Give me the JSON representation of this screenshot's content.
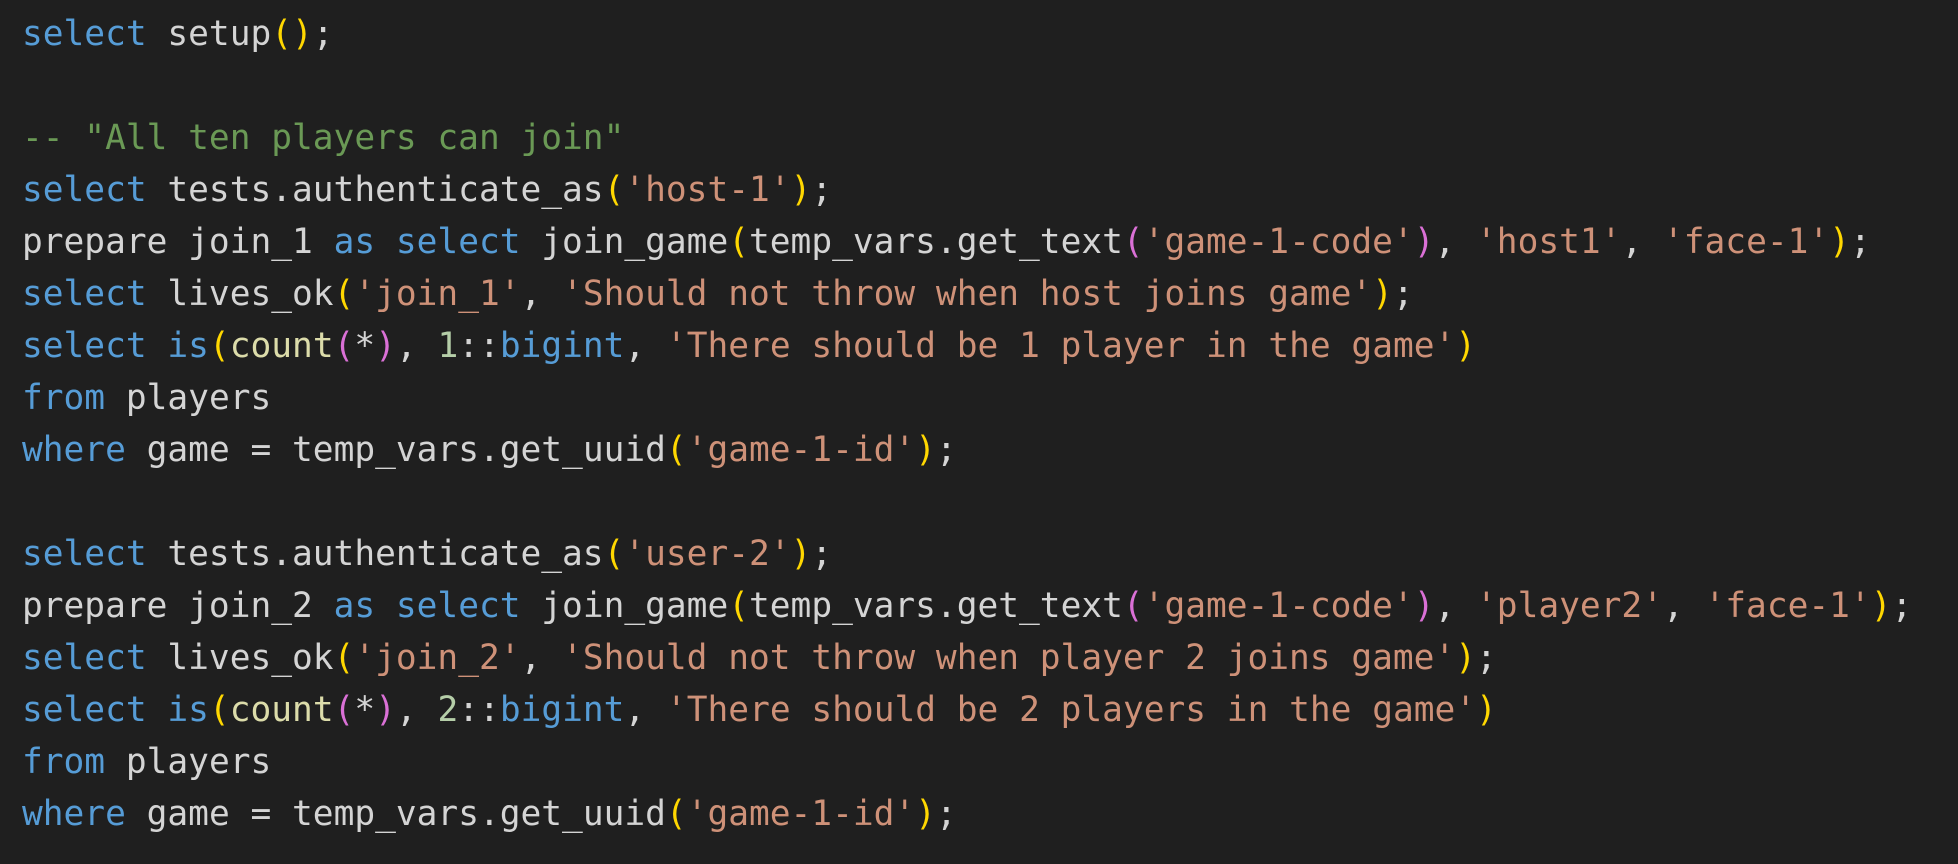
{
  "editor": {
    "colors": {
      "background": "#1f1f1f",
      "keyword": "#569cd6",
      "function": "#dcdcaa",
      "plain": "#d4d4d4",
      "string": "#ce9178",
      "comment": "#6a9955",
      "number": "#b5cea8",
      "paren1": "#ffd700",
      "paren2": "#da70d6"
    },
    "lines": [
      {
        "tokens": [
          {
            "text": "select",
            "type": "keyword"
          },
          {
            "text": " setup",
            "type": "plain"
          },
          {
            "text": "()",
            "type": "paren1"
          },
          {
            "text": ";",
            "type": "plain"
          }
        ]
      },
      {
        "tokens": []
      },
      {
        "tokens": [
          {
            "text": "-- \"All ten players can join\"",
            "type": "comment"
          }
        ]
      },
      {
        "tokens": [
          {
            "text": "select",
            "type": "keyword"
          },
          {
            "text": " tests.authenticate_as",
            "type": "plain"
          },
          {
            "text": "(",
            "type": "paren1"
          },
          {
            "text": "'host-1'",
            "type": "string"
          },
          {
            "text": ")",
            "type": "paren1"
          },
          {
            "text": ";",
            "type": "plain"
          }
        ]
      },
      {
        "tokens": [
          {
            "text": "prepare join_1 ",
            "type": "plain"
          },
          {
            "text": "as",
            "type": "keyword"
          },
          {
            "text": " ",
            "type": "plain"
          },
          {
            "text": "select",
            "type": "keyword"
          },
          {
            "text": " join_game",
            "type": "plain"
          },
          {
            "text": "(",
            "type": "paren1"
          },
          {
            "text": "temp_vars.get_text",
            "type": "plain"
          },
          {
            "text": "(",
            "type": "paren2"
          },
          {
            "text": "'game-1-code'",
            "type": "string"
          },
          {
            "text": ")",
            "type": "paren2"
          },
          {
            "text": ", ",
            "type": "plain"
          },
          {
            "text": "'host1'",
            "type": "string"
          },
          {
            "text": ", ",
            "type": "plain"
          },
          {
            "text": "'face-1'",
            "type": "string"
          },
          {
            "text": ")",
            "type": "paren1"
          },
          {
            "text": ";",
            "type": "plain"
          }
        ]
      },
      {
        "tokens": [
          {
            "text": "select",
            "type": "keyword"
          },
          {
            "text": " lives_ok",
            "type": "plain"
          },
          {
            "text": "(",
            "type": "paren1"
          },
          {
            "text": "'join_1'",
            "type": "string"
          },
          {
            "text": ", ",
            "type": "plain"
          },
          {
            "text": "'Should not throw when host joins game'",
            "type": "string"
          },
          {
            "text": ")",
            "type": "paren1"
          },
          {
            "text": ";",
            "type": "plain"
          }
        ]
      },
      {
        "tokens": [
          {
            "text": "select",
            "type": "keyword"
          },
          {
            "text": " ",
            "type": "plain"
          },
          {
            "text": "is",
            "type": "keyword"
          },
          {
            "text": "(",
            "type": "paren1"
          },
          {
            "text": "count",
            "type": "function"
          },
          {
            "text": "(",
            "type": "paren2"
          },
          {
            "text": "*",
            "type": "plain"
          },
          {
            "text": ")",
            "type": "paren2"
          },
          {
            "text": ", ",
            "type": "plain"
          },
          {
            "text": "1",
            "type": "number"
          },
          {
            "text": "::",
            "type": "plain"
          },
          {
            "text": "bigint",
            "type": "type"
          },
          {
            "text": ", ",
            "type": "plain"
          },
          {
            "text": "'There should be 1 player in the game'",
            "type": "string"
          },
          {
            "text": ")",
            "type": "paren1"
          }
        ]
      },
      {
        "tokens": [
          {
            "text": "from",
            "type": "keyword"
          },
          {
            "text": " players",
            "type": "plain"
          }
        ]
      },
      {
        "tokens": [
          {
            "text": "where",
            "type": "keyword"
          },
          {
            "text": " game = temp_vars.get_uuid",
            "type": "plain"
          },
          {
            "text": "(",
            "type": "paren1"
          },
          {
            "text": "'game-1-id'",
            "type": "string"
          },
          {
            "text": ")",
            "type": "paren1"
          },
          {
            "text": ";",
            "type": "plain"
          }
        ]
      },
      {
        "tokens": []
      },
      {
        "tokens": [
          {
            "text": "select",
            "type": "keyword"
          },
          {
            "text": " tests.authenticate_as",
            "type": "plain"
          },
          {
            "text": "(",
            "type": "paren1"
          },
          {
            "text": "'user-2'",
            "type": "string"
          },
          {
            "text": ")",
            "type": "paren1"
          },
          {
            "text": ";",
            "type": "plain"
          }
        ]
      },
      {
        "tokens": [
          {
            "text": "prepare join_2 ",
            "type": "plain"
          },
          {
            "text": "as",
            "type": "keyword"
          },
          {
            "text": " ",
            "type": "plain"
          },
          {
            "text": "select",
            "type": "keyword"
          },
          {
            "text": " join_game",
            "type": "plain"
          },
          {
            "text": "(",
            "type": "paren1"
          },
          {
            "text": "temp_vars.get_text",
            "type": "plain"
          },
          {
            "text": "(",
            "type": "paren2"
          },
          {
            "text": "'game-1-code'",
            "type": "string"
          },
          {
            "text": ")",
            "type": "paren2"
          },
          {
            "text": ", ",
            "type": "plain"
          },
          {
            "text": "'player2'",
            "type": "string"
          },
          {
            "text": ", ",
            "type": "plain"
          },
          {
            "text": "'face-1'",
            "type": "string"
          },
          {
            "text": ")",
            "type": "paren1"
          },
          {
            "text": ";",
            "type": "plain"
          }
        ]
      },
      {
        "tokens": [
          {
            "text": "select",
            "type": "keyword"
          },
          {
            "text": " lives_ok",
            "type": "plain"
          },
          {
            "text": "(",
            "type": "paren1"
          },
          {
            "text": "'join_2'",
            "type": "string"
          },
          {
            "text": ", ",
            "type": "plain"
          },
          {
            "text": "'Should not throw when player 2 joins game'",
            "type": "string"
          },
          {
            "text": ")",
            "type": "paren1"
          },
          {
            "text": ";",
            "type": "plain"
          }
        ]
      },
      {
        "tokens": [
          {
            "text": "select",
            "type": "keyword"
          },
          {
            "text": " ",
            "type": "plain"
          },
          {
            "text": "is",
            "type": "keyword"
          },
          {
            "text": "(",
            "type": "paren1"
          },
          {
            "text": "count",
            "type": "function"
          },
          {
            "text": "(",
            "type": "paren2"
          },
          {
            "text": "*",
            "type": "plain"
          },
          {
            "text": ")",
            "type": "paren2"
          },
          {
            "text": ", ",
            "type": "plain"
          },
          {
            "text": "2",
            "type": "number"
          },
          {
            "text": "::",
            "type": "plain"
          },
          {
            "text": "bigint",
            "type": "type"
          },
          {
            "text": ", ",
            "type": "plain"
          },
          {
            "text": "'There should be 2 players in the game'",
            "type": "string"
          },
          {
            "text": ")",
            "type": "paren1"
          }
        ]
      },
      {
        "tokens": [
          {
            "text": "from",
            "type": "keyword"
          },
          {
            "text": " players",
            "type": "plain"
          }
        ]
      },
      {
        "tokens": [
          {
            "text": "where",
            "type": "keyword"
          },
          {
            "text": " game = temp_vars.get_uuid",
            "type": "plain"
          },
          {
            "text": "(",
            "type": "paren1"
          },
          {
            "text": "'game-1-id'",
            "type": "string"
          },
          {
            "text": ")",
            "type": "paren1"
          },
          {
            "text": ";",
            "type": "plain"
          }
        ]
      }
    ]
  }
}
